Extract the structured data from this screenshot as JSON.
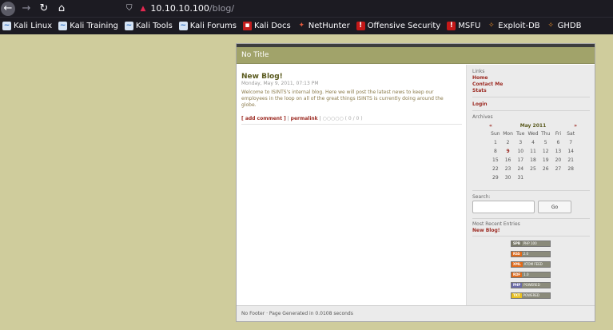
{
  "browser": {
    "url_host": "10.10.10.100",
    "url_path": "/blog/",
    "bookmarks": [
      {
        "label": "Kali Linux",
        "icon": "kali-dragon-icon"
      },
      {
        "label": "Kali Training",
        "icon": "kali-dragon-icon"
      },
      {
        "label": "Kali Tools",
        "icon": "kali-dragon-icon"
      },
      {
        "label": "Kali Forums",
        "icon": "kali-dragon-icon"
      },
      {
        "label": "Kali Docs",
        "icon": "kali-docs-icon"
      },
      {
        "label": "NetHunter",
        "icon": "nethunter-icon"
      },
      {
        "label": "Offensive Security",
        "icon": "offsec-icon"
      },
      {
        "label": "MSFU",
        "icon": "offsec-icon"
      },
      {
        "label": "Exploit-DB",
        "icon": "exploitdb-icon"
      },
      {
        "label": "GHDB",
        "icon": "exploitdb-icon"
      }
    ]
  },
  "blog": {
    "title": "No Title",
    "post": {
      "title": "New Blog!",
      "date": "Monday, May 9, 2011, 07:13 PM",
      "body": "Welcome to ISINTS's internal blog. Here we will post the latest news to keep our employees in the loop on all of the great things ISINTS is currently doing around the globe.",
      "add_comment": "[ add comment ]",
      "separator": "|",
      "permalink": "permalink",
      "rating_stars": "○○○○○",
      "rating_count": "( 0 / 0 )"
    },
    "sidebar": {
      "links_heading": "Links",
      "links": [
        "Home",
        "Contact Me",
        "Stats"
      ],
      "login": "Login",
      "archives_heading": "Archives",
      "calendar": {
        "prev": "«",
        "month": "May 2011",
        "next": "»",
        "days_of_week": [
          "Sun",
          "Mon",
          "Tue",
          "Wed",
          "Thu",
          "Fri",
          "Sat"
        ],
        "dates": [
          "1",
          "2",
          "3",
          "4",
          "5",
          "6",
          "7",
          "8",
          "9",
          "10",
          "11",
          "12",
          "13",
          "14",
          "15",
          "16",
          "17",
          "18",
          "19",
          "20",
          "21",
          "22",
          "23",
          "24",
          "25",
          "26",
          "27",
          "28",
          "29",
          "30",
          "31"
        ],
        "highlighted": "9"
      },
      "search_label": "Search:",
      "search_button": "Go",
      "recent_heading": "Most Recent Entries",
      "recent_entries": [
        "New Blog!"
      ],
      "badges": [
        {
          "left": "SPB",
          "right": "PHP 100",
          "color": "#7a7a6a"
        },
        {
          "left": "RSS",
          "right": "2.0",
          "color": "#e06a1a"
        },
        {
          "left": "XML",
          "right": "ATOM FEED",
          "color": "#e06a1a"
        },
        {
          "left": "RDF",
          "right": "1.0",
          "color": "#e06a1a"
        },
        {
          "left": "PHP",
          "right": "POWERED",
          "color": "#6a6aa8"
        },
        {
          "left": "TXT",
          "right": "POWERED",
          "color": "#e8c020"
        }
      ]
    },
    "footer": "No Footer · Page Generated in 0.0108 seconds"
  }
}
